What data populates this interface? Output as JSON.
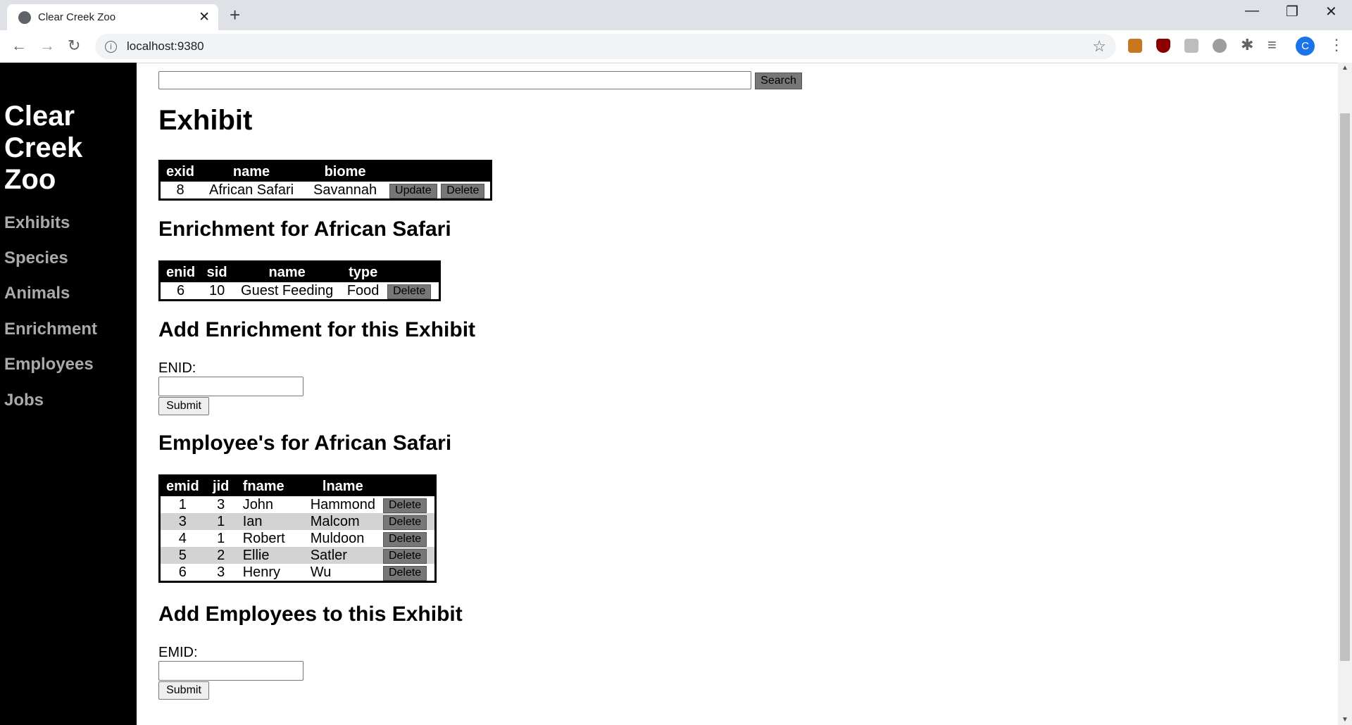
{
  "browser": {
    "tab_title": "Clear Creek Zoo",
    "url": "localhost:9380",
    "profile_initial": "C"
  },
  "sidebar": {
    "brand_lines": [
      "Clear",
      "Creek",
      "Zoo"
    ],
    "items": [
      {
        "label": "Exhibits"
      },
      {
        "label": "Species"
      },
      {
        "label": "Animals"
      },
      {
        "label": "Enrichment"
      },
      {
        "label": "Employees"
      },
      {
        "label": "Jobs"
      }
    ]
  },
  "search": {
    "button_label": "Search",
    "value": ""
  },
  "exhibit": {
    "heading": "Exhibit",
    "columns": [
      "exid",
      "name",
      "biome"
    ],
    "row": {
      "exid": "8",
      "name": "African Safari",
      "biome": "Savannah"
    },
    "update_label": "Update",
    "delete_label": "Delete"
  },
  "enrichment": {
    "heading": "Enrichment for African Safari",
    "columns": [
      "enid",
      "sid",
      "name",
      "type"
    ],
    "row": {
      "enid": "6",
      "sid": "10",
      "name": "Guest Feeding",
      "type": "Food"
    },
    "delete_label": "Delete"
  },
  "add_enrichment": {
    "heading": "Add Enrichment for this Exhibit",
    "field_label": "ENID:",
    "submit_label": "Submit"
  },
  "employees": {
    "heading": "Employee's for African Safari",
    "columns": [
      "emid",
      "jid",
      "fname",
      "lname"
    ],
    "rows": [
      {
        "emid": "1",
        "jid": "3",
        "fname": "John",
        "lname": "Hammond"
      },
      {
        "emid": "3",
        "jid": "1",
        "fname": "Ian",
        "lname": "Malcom"
      },
      {
        "emid": "4",
        "jid": "1",
        "fname": "Robert",
        "lname": "Muldoon"
      },
      {
        "emid": "5",
        "jid": "2",
        "fname": "Ellie",
        "lname": "Satler"
      },
      {
        "emid": "6",
        "jid": "3",
        "fname": "Henry",
        "lname": "Wu"
      }
    ],
    "delete_label": "Delete"
  },
  "add_employee": {
    "heading": "Add Employees to this Exhibit",
    "field_label": "EMID:",
    "submit_label": "Submit"
  },
  "colors": {
    "sidebar_bg": "#000000",
    "nav_link": "#aaaaaa",
    "table_header_bg": "#000000",
    "row_alt_bg": "#d3d3d3",
    "action_button_bg": "#777777"
  },
  "icons": [
    "globe-icon",
    "close-icon",
    "plus-icon",
    "back-icon",
    "forward-icon",
    "reload-icon",
    "info-icon",
    "star-icon",
    "puzzle-icon",
    "menu-icon"
  ]
}
